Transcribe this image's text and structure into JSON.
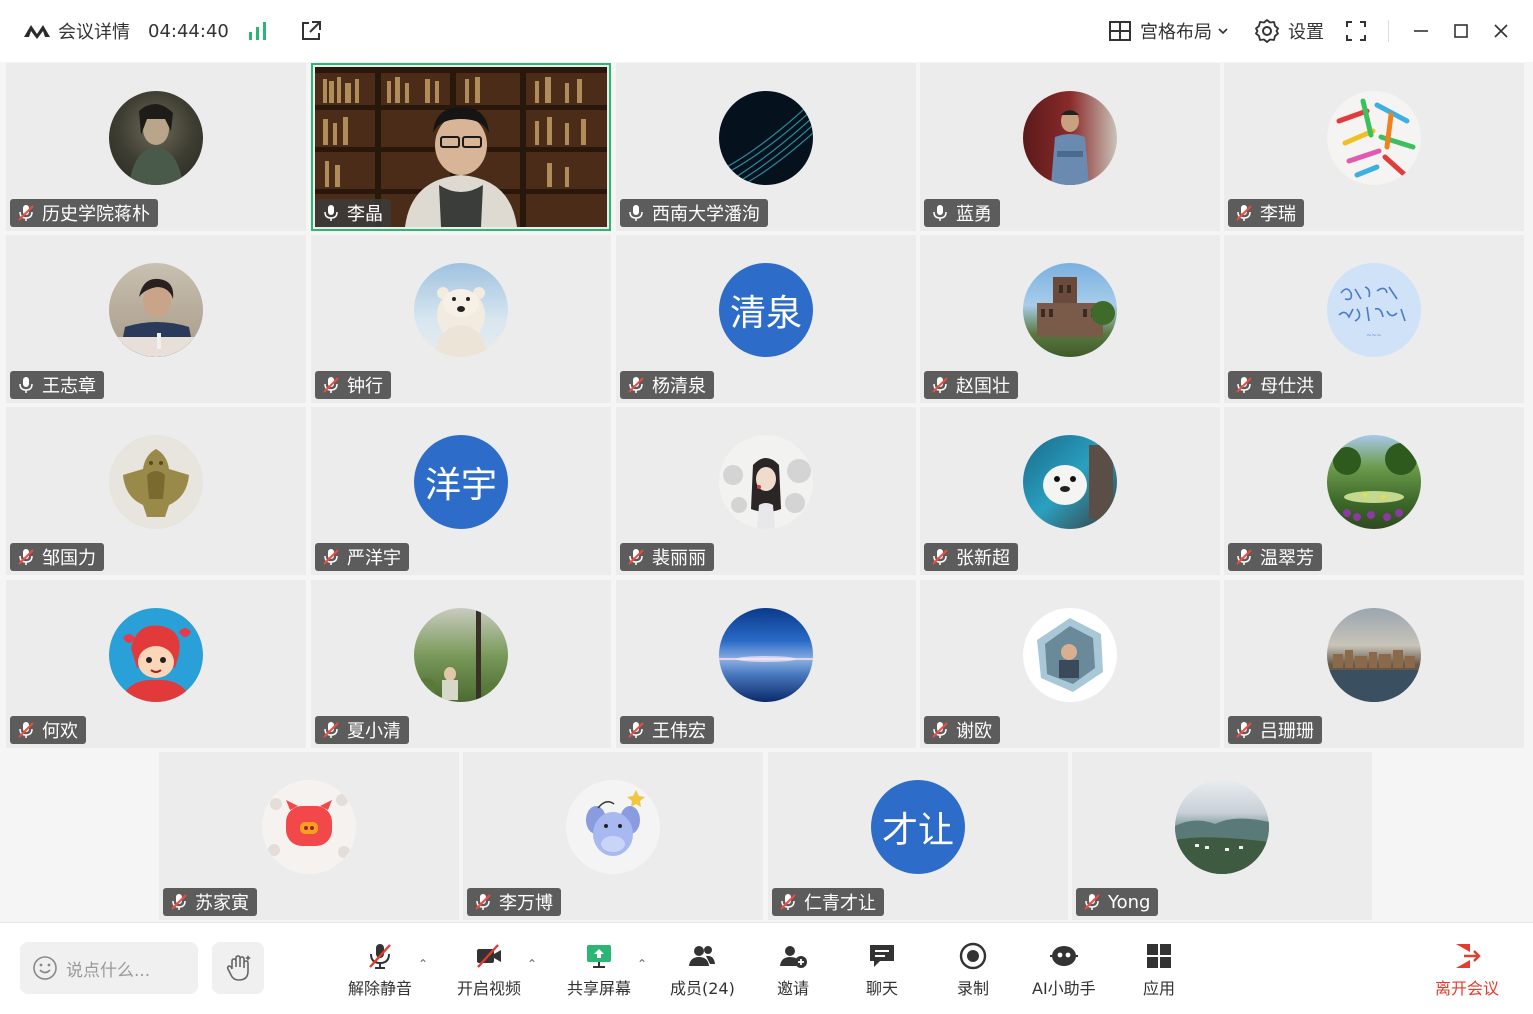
{
  "titlebar": {
    "title": "会议详情",
    "timer": "04:44:40",
    "layout_label": "宫格布局",
    "settings_label": "设置"
  },
  "participants": [
    {
      "name": "历史学院蒋朴",
      "muted": true,
      "avatar": "photo-dark-figure"
    },
    {
      "name": "李晶",
      "muted": false,
      "video": true,
      "avatar": "video-bookshelf"
    },
    {
      "name": "西南大学潘洵",
      "muted": false,
      "avatar": "photo-dark-waves"
    },
    {
      "name": "蓝勇",
      "muted": false,
      "avatar": "photo-man"
    },
    {
      "name": "李瑞",
      "muted": true,
      "avatar": "photo-colorful"
    },
    {
      "name": "王志章",
      "muted": false,
      "avatar": "photo-speaker"
    },
    {
      "name": "钟行",
      "muted": true,
      "avatar": "photo-polar-bear"
    },
    {
      "name": "杨清泉",
      "muted": true,
      "avatar_text": "清泉"
    },
    {
      "name": "赵国壮",
      "muted": true,
      "avatar": "photo-building"
    },
    {
      "name": "母仕洪",
      "muted": true,
      "avatar": "photo-handwriting"
    },
    {
      "name": "邹国力",
      "muted": true,
      "avatar": "photo-jade-bird"
    },
    {
      "name": "严洋宇",
      "muted": true,
      "avatar_text": "洋宇"
    },
    {
      "name": "裴丽丽",
      "muted": true,
      "avatar": "photo-ink-girl"
    },
    {
      "name": "张新超",
      "muted": true,
      "avatar": "photo-seal"
    },
    {
      "name": "温翠芳",
      "muted": true,
      "avatar": "photo-garden"
    },
    {
      "name": "何欢",
      "muted": true,
      "avatar": "photo-ponyo"
    },
    {
      "name": "夏小清",
      "muted": true,
      "avatar": "photo-field"
    },
    {
      "name": "王伟宏",
      "muted": true,
      "avatar": "photo-sea-sky"
    },
    {
      "name": "谢欧",
      "muted": true,
      "avatar": "photo-child"
    },
    {
      "name": "吕珊珊",
      "muted": true,
      "avatar": "photo-town"
    },
    {
      "name": "苏家寅",
      "muted": true,
      "avatar": "photo-pig"
    },
    {
      "name": "李万博",
      "muted": true,
      "avatar": "photo-donkey"
    },
    {
      "name": "仁青才让",
      "muted": true,
      "avatar_text": "才让"
    },
    {
      "name": "Yong",
      "muted": true,
      "avatar": "photo-mountain"
    }
  ],
  "bottombar": {
    "chat_placeholder": "说点什么...",
    "tools": [
      {
        "label": "解除静音",
        "icon": "mic-off-icon"
      },
      {
        "label": "开启视频",
        "icon": "camera-off-icon"
      },
      {
        "label": "共享屏幕",
        "icon": "share-screen-icon"
      },
      {
        "label": "成员(24)",
        "icon": "members-icon"
      },
      {
        "label": "邀请",
        "icon": "invite-icon"
      },
      {
        "label": "聊天",
        "icon": "chat-icon"
      },
      {
        "label": "录制",
        "icon": "record-icon"
      },
      {
        "label": "AI小助手",
        "icon": "ai-assistant-icon"
      },
      {
        "label": "应用",
        "icon": "apps-icon"
      }
    ],
    "leave_label": "离开会议"
  },
  "colors": {
    "accent_green": "#2bb673",
    "leave_red": "#e33b2e",
    "text_avatar_blue": "#2d6dc9"
  }
}
